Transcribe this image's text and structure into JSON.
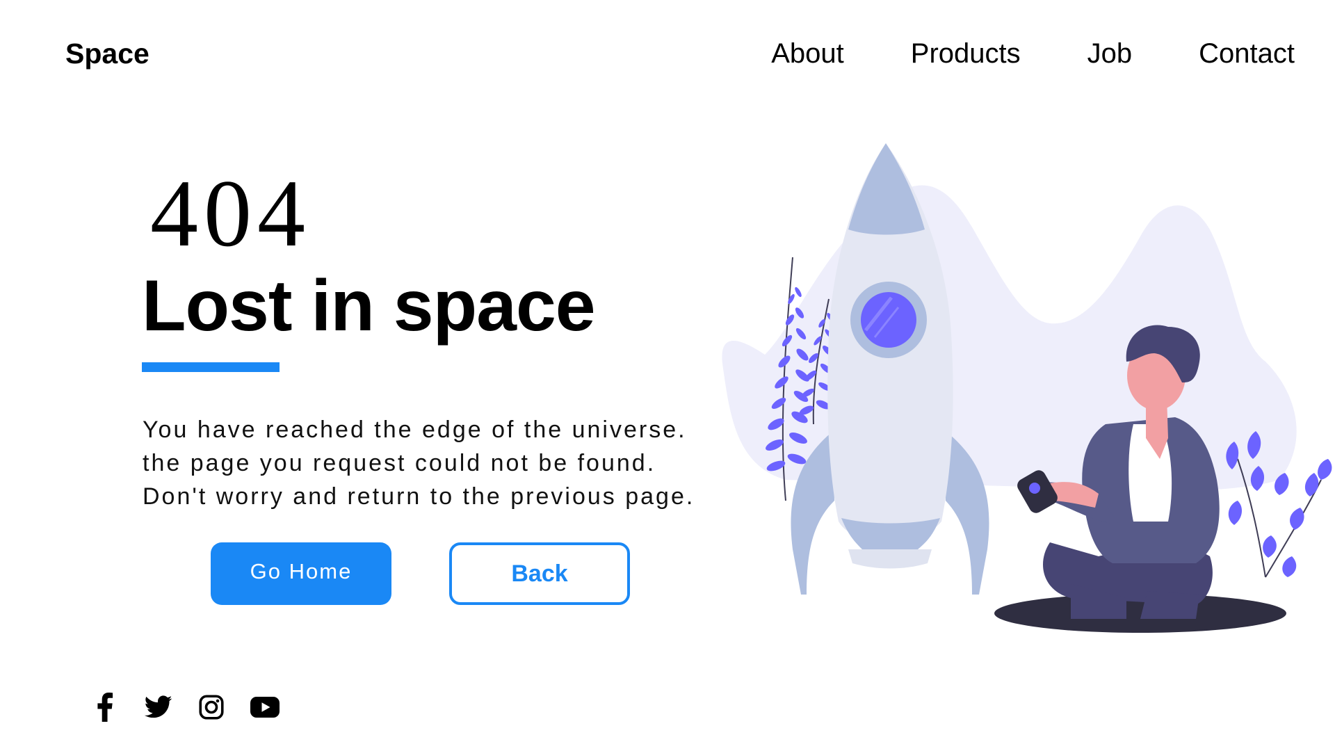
{
  "header": {
    "logo": "Space",
    "nav": [
      "About",
      "Products",
      "Job",
      "Contact"
    ]
  },
  "hero": {
    "code": "404",
    "headline": "Lost in space",
    "description": [
      "You have reached the edge of the universe.",
      "the page you request could not be found.",
      "Don't worry and return to the previous page."
    ],
    "home_button": "Go Home",
    "back_button": "Back"
  },
  "social": {
    "icons": [
      "facebook-icon",
      "twitter-icon",
      "instagram-icon",
      "youtube-icon"
    ]
  },
  "colors": {
    "accent": "#1a88f5",
    "illustration_primary": "#6c63ff",
    "rocket_body": "#e4e7f3",
    "rocket_trim": "#aebedf",
    "backdrop": "#eeeefb"
  }
}
